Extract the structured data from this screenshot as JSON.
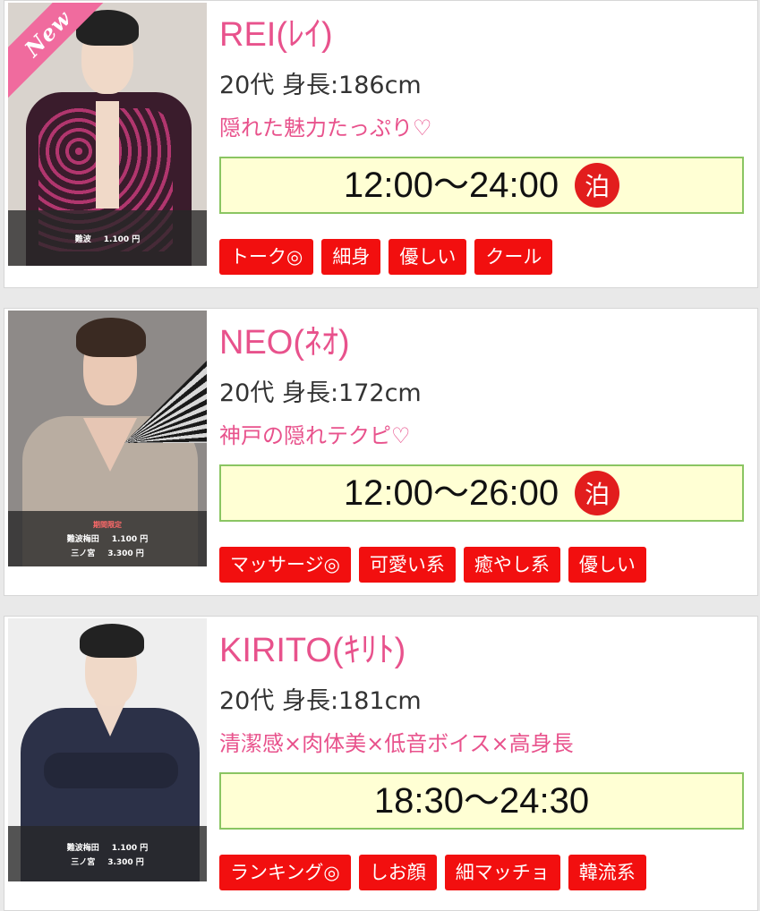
{
  "cards": [
    {
      "badge": "New",
      "name": "REI(ﾚｲ)",
      "age_height": "20代 身長:186cm",
      "catchphrase": "隠れた魅力たっぷり♡",
      "hours": "12:00〜24:00",
      "stay_mark": "泊",
      "price_limited": "",
      "prices": [
        {
          "area": "難波",
          "price": "1.100 円"
        }
      ],
      "tags": [
        "トーク◎",
        "細身",
        "優しい",
        "クール"
      ]
    },
    {
      "badge": "",
      "name": "NEO(ﾈｵ)",
      "age_height": "20代 身長:172cm",
      "catchphrase": "神戸の隠れテクピ♡",
      "hours": "12:00〜26:00",
      "stay_mark": "泊",
      "price_limited": "期間限定",
      "prices": [
        {
          "area": "難波梅田",
          "price": "1.100 円"
        },
        {
          "area": "三ノ宮",
          "price": "3.300 円"
        }
      ],
      "tags": [
        "マッサージ◎",
        "可愛い系",
        "癒やし系",
        "優しい"
      ]
    },
    {
      "badge": "",
      "name": "KIRITO(ｷﾘﾄ)",
      "age_height": "20代 身長:181cm",
      "catchphrase": "清潔感×肉体美×低音ボイス×高身長",
      "hours": "18:30〜24:30",
      "stay_mark": "",
      "price_limited": "",
      "prices": [
        {
          "area": "難波梅田",
          "price": "1.100 円"
        },
        {
          "area": "三ノ宮",
          "price": "3.300 円"
        }
      ],
      "tags": [
        "ランキング◎",
        "しお顔",
        "細マッチョ",
        "韓流系"
      ]
    }
  ],
  "colors": {
    "name_pink": "#e8528c",
    "tag_red": "#f20f0f",
    "hours_bg": "#ffffd4",
    "hours_border": "#8ac562",
    "stay_red": "#e21d1d"
  }
}
